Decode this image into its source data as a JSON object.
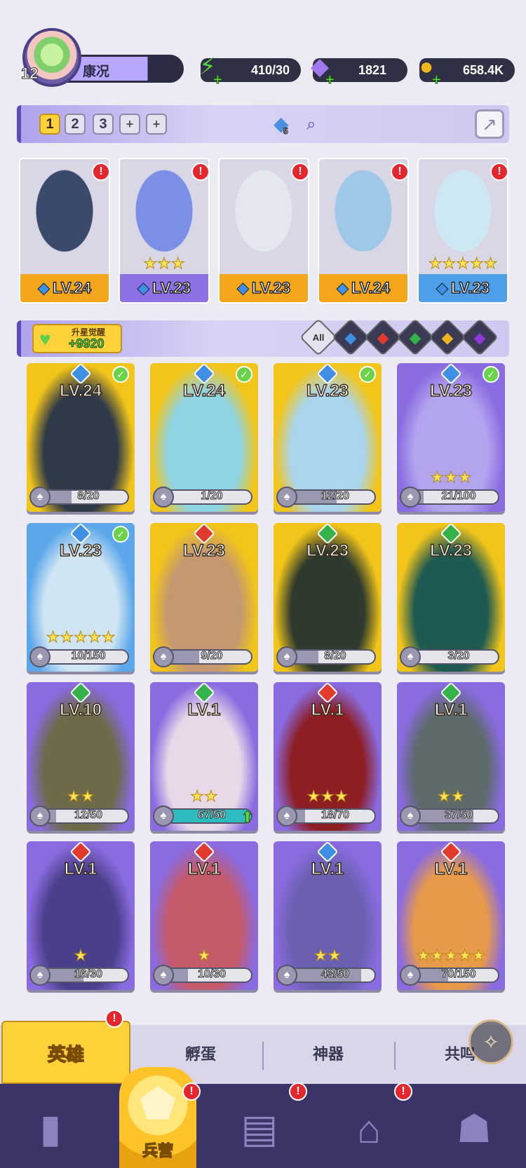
{
  "player": {
    "level": "12",
    "name": "康况"
  },
  "resources": {
    "energy": {
      "value": "410/30",
      "icon": "lightning-icon"
    },
    "gems": {
      "value": "1821",
      "icon": "diamond-icon"
    },
    "coins": {
      "value": "658.4K",
      "icon": "coin-icon"
    }
  },
  "team": {
    "tabs": [
      "1",
      "2",
      "3",
      "+",
      "+"
    ],
    "active_tab": "1",
    "gem_count": "5",
    "cards": [
      {
        "level": "LV.24",
        "element": "water",
        "stars": "",
        "color": "#f3a51b",
        "art": "#3b4a6a"
      },
      {
        "level": "LV.23",
        "element": "water",
        "stars": "★★★",
        "color": "#8d6fe6",
        "art": "#7b8fe6"
      },
      {
        "level": "LV.23",
        "element": "water",
        "stars": "",
        "color": "#f3a51b",
        "art": "#e5e7ef"
      },
      {
        "level": "LV.24",
        "element": "water",
        "stars": "",
        "color": "#f3a51b",
        "art": "#9fc7e8"
      },
      {
        "level": "LV.23",
        "element": "water",
        "stars": "★★★★★",
        "color": "#4f9fe8",
        "art": "#cde7f3"
      }
    ]
  },
  "awaken": {
    "label": "升星觉醒",
    "value": "+9920"
  },
  "element_filters": [
    "All",
    "water",
    "fire",
    "earth",
    "light",
    "dark"
  ],
  "heroes": [
    {
      "level": "LV.24",
      "element": "water",
      "check": true,
      "frag": "8/20",
      "ratio": 0.4,
      "stars": "",
      "bg": "#f2c51a",
      "art": "#2f3a48"
    },
    {
      "level": "LV.24",
      "element": "water",
      "check": true,
      "frag": "1/20",
      "ratio": 0.05,
      "stars": "",
      "bg": "#f2c51a",
      "art": "#8fd4e4"
    },
    {
      "level": "LV.23",
      "element": "water",
      "check": true,
      "frag": "12/20",
      "ratio": 0.6,
      "stars": "",
      "bg": "#f2c51a",
      "art": "#a9d5ee"
    },
    {
      "level": "LV.23",
      "element": "water",
      "check": true,
      "frag": "21/100",
      "ratio": 0.21,
      "stars": "★★★",
      "bg": "#8a6be0",
      "art": "#b3a4ef"
    },
    {
      "level": "LV.23",
      "element": "water",
      "check": true,
      "frag": "10/150",
      "ratio": 0.07,
      "stars": "★★★★★",
      "bg": "#5ba7ea",
      "art": "#cfe5f3"
    },
    {
      "level": "LV.23",
      "element": "fire",
      "check": false,
      "frag": "9/20",
      "ratio": 0.45,
      "stars": "",
      "bg": "#f2c51a",
      "art": "#c49870"
    },
    {
      "level": "LV.23",
      "element": "earth",
      "check": false,
      "frag": "8/20",
      "ratio": 0.4,
      "stars": "",
      "bg": "#f2c51a",
      "art": "#2f3a2f"
    },
    {
      "level": "LV.23",
      "element": "earth",
      "check": false,
      "frag": "3/20",
      "ratio": 0.15,
      "stars": "",
      "bg": "#f2c51a",
      "art": "#1f5a52"
    },
    {
      "level": "LV.10",
      "element": "earth",
      "check": false,
      "frag": "12/50",
      "ratio": 0.24,
      "stars": "★★",
      "bg": "#8a6be0",
      "art": "#6d6a4a"
    },
    {
      "level": "LV.1",
      "element": "earth",
      "check": false,
      "frag": "67/50",
      "ratio": 1.0,
      "stars": "★★",
      "bg": "#8a6be0",
      "art": "#e9d8e8",
      "upgrade": true
    },
    {
      "level": "LV.1",
      "element": "fire",
      "check": false,
      "frag": "18/70",
      "ratio": 0.26,
      "stars": "★★★",
      "bg": "#8a6be0",
      "art": "#8c1e24"
    },
    {
      "level": "LV.1",
      "element": "earth",
      "check": false,
      "frag": "37/50",
      "ratio": 0.74,
      "stars": "★★",
      "bg": "#8a6be0",
      "art": "#5c6a6a"
    },
    {
      "level": "LV.1",
      "element": "fire",
      "check": false,
      "frag": "16/30",
      "ratio": 0.53,
      "stars": "★",
      "bg": "#8a6be0",
      "art": "#4a3f8a"
    },
    {
      "level": "LV.1",
      "element": "fire",
      "check": false,
      "frag": "10/30",
      "ratio": 0.33,
      "stars": "★",
      "bg": "#8a6be0",
      "art": "#c55a6a"
    },
    {
      "level": "LV.1",
      "element": "water",
      "check": false,
      "frag": "43/50",
      "ratio": 0.86,
      "stars": "★★",
      "bg": "#8a6be0",
      "art": "#6a5fb0"
    },
    {
      "level": "LV.1",
      "element": "fire",
      "check": false,
      "frag": "70/150",
      "ratio": 0.47,
      "stars": "★★★★★",
      "bg": "#8a6be0",
      "art": "#e79a4a"
    }
  ],
  "colors": {
    "water": "#3f8fe5",
    "fire": "#e23a2c",
    "earth": "#36b24a",
    "light": "#f0b321",
    "dark": "#8e3ad6"
  },
  "subtabs": {
    "heroes": "英雄",
    "hatch": "孵蛋",
    "artifacts": "神器",
    "resonance": "共鸣"
  },
  "bottom_nav": {
    "active_label": "兵营"
  }
}
